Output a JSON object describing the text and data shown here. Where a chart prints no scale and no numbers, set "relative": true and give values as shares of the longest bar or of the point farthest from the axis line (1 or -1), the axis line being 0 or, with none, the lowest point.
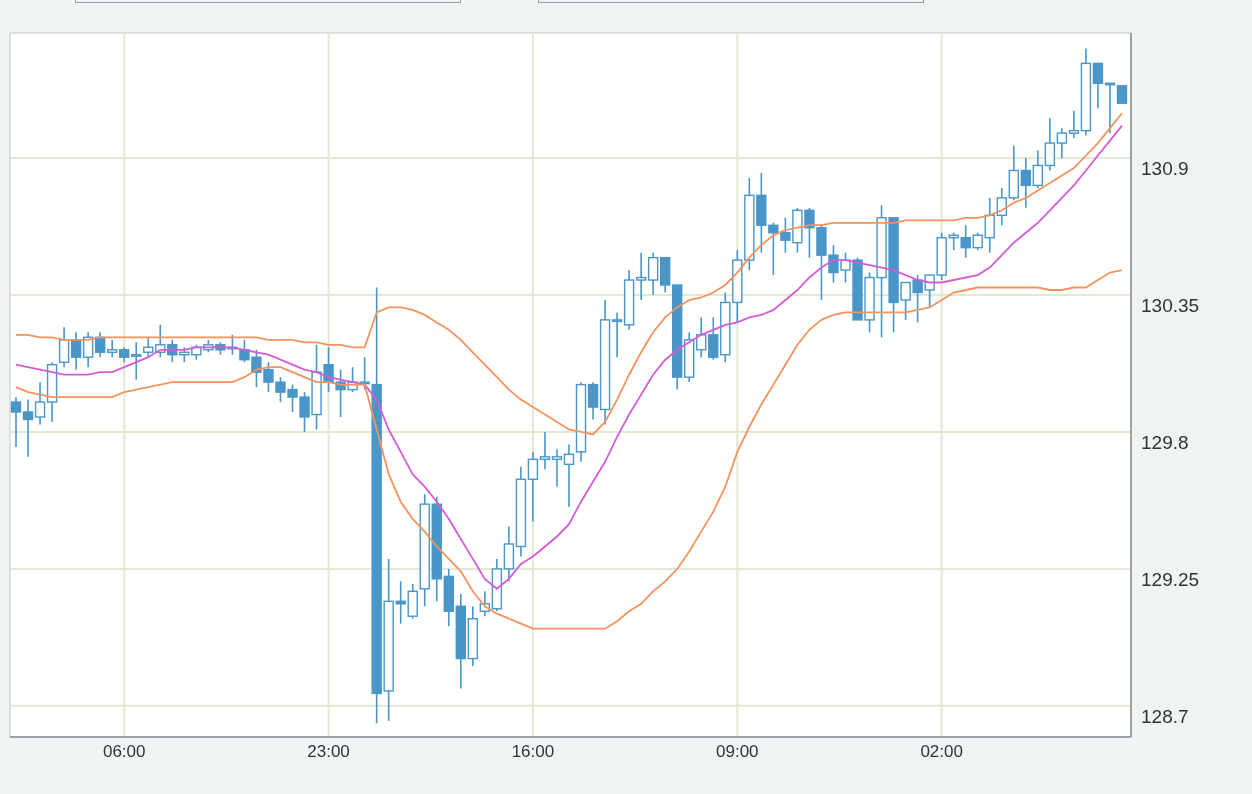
{
  "chart": {
    "chart_data": {
      "type": "candlestick",
      "grid": true,
      "categories": [
        null,
        null,
        null,
        null,
        null,
        null,
        null,
        null,
        null,
        "06:00",
        null,
        null,
        null,
        null,
        null,
        null,
        null,
        null,
        null,
        null,
        null,
        null,
        null,
        null,
        null,
        null,
        "23:00",
        null,
        null,
        null,
        null,
        null,
        null,
        null,
        null,
        null,
        null,
        null,
        null,
        null,
        null,
        null,
        null,
        "16:00",
        null,
        null,
        null,
        null,
        null,
        null,
        null,
        null,
        null,
        null,
        null,
        null,
        null,
        null,
        null,
        null,
        "09:00",
        null,
        null,
        null,
        null,
        null,
        null,
        null,
        null,
        null,
        null,
        null,
        null,
        null,
        null,
        null,
        null,
        "02:00",
        null,
        null,
        null,
        null,
        null,
        null,
        null,
        null,
        null,
        null,
        null,
        null,
        null,
        null,
        null
      ],
      "ylim": [
        128.575,
        131.402
      ],
      "yticks": [
        128.7,
        129.25,
        129.8,
        130.35,
        130.9
      ],
      "ohlc": [
        [
          129.92,
          129.94,
          129.74,
          129.88
        ],
        [
          129.88,
          129.93,
          129.7,
          129.85
        ],
        [
          129.86,
          130.0,
          129.83,
          129.92
        ],
        [
          129.92,
          130.08,
          129.84,
          130.07
        ],
        [
          130.08,
          130.22,
          130.06,
          130.17
        ],
        [
          130.17,
          130.2,
          130.05,
          130.1
        ],
        [
          130.1,
          130.2,
          130.06,
          130.18
        ],
        [
          130.18,
          130.2,
          130.1,
          130.12
        ],
        [
          130.12,
          130.17,
          130.1,
          130.13
        ],
        [
          130.13,
          130.14,
          130.08,
          130.1
        ],
        [
          130.11,
          130.16,
          130.01,
          130.11
        ],
        [
          130.12,
          130.18,
          130.1,
          130.14
        ],
        [
          130.12,
          130.23,
          130.1,
          130.15
        ],
        [
          130.15,
          130.17,
          130.08,
          130.11
        ],
        [
          130.11,
          130.14,
          130.08,
          130.12
        ],
        [
          130.11,
          130.15,
          130.09,
          130.14
        ],
        [
          130.13,
          130.17,
          130.12,
          130.15
        ],
        [
          130.15,
          130.16,
          130.11,
          130.13
        ],
        [
          130.14,
          130.19,
          130.11,
          130.14
        ],
        [
          130.13,
          130.17,
          130.08,
          130.09
        ],
        [
          130.1,
          130.13,
          129.98,
          130.04
        ],
        [
          130.05,
          130.08,
          129.96,
          130.0
        ],
        [
          130.0,
          130.02,
          129.92,
          129.96
        ],
        [
          129.97,
          129.99,
          129.88,
          129.94
        ],
        [
          129.94,
          129.96,
          129.8,
          129.86
        ],
        [
          129.87,
          130.15,
          129.81,
          130.04
        ],
        [
          130.07,
          130.14,
          129.96,
          130.0
        ],
        [
          130.0,
          130.05,
          129.86,
          129.97
        ],
        [
          129.97,
          130.06,
          129.96,
          130.0
        ],
        [
          130.0,
          130.1,
          129.97,
          130.0
        ],
        [
          129.99,
          130.38,
          128.63,
          128.75
        ],
        [
          128.76,
          129.29,
          128.64,
          129.12
        ],
        [
          129.12,
          129.2,
          129.03,
          129.11
        ],
        [
          129.06,
          129.19,
          129.05,
          129.16
        ],
        [
          129.17,
          129.55,
          129.1,
          129.51
        ],
        [
          129.51,
          129.54,
          129.12,
          129.21
        ],
        [
          129.22,
          129.25,
          129.02,
          129.08
        ],
        [
          129.1,
          129.15,
          128.77,
          128.89
        ],
        [
          128.89,
          129.1,
          128.86,
          129.05
        ],
        [
          129.08,
          129.16,
          129.06,
          129.11
        ],
        [
          129.09,
          129.29,
          129.08,
          129.25
        ],
        [
          129.25,
          129.42,
          129.2,
          129.35
        ],
        [
          129.34,
          129.66,
          129.3,
          129.61
        ],
        [
          129.61,
          129.72,
          129.44,
          129.69
        ],
        [
          129.69,
          129.8,
          129.65,
          129.7
        ],
        [
          129.69,
          129.73,
          129.58,
          129.7
        ],
        [
          129.67,
          129.75,
          129.5,
          129.71
        ],
        [
          129.72,
          130.0,
          129.68,
          129.99
        ],
        [
          129.99,
          130.0,
          129.85,
          129.9
        ],
        [
          129.89,
          130.33,
          129.83,
          130.25
        ],
        [
          130.25,
          130.28,
          130.1,
          130.25
        ],
        [
          130.23,
          130.45,
          130.21,
          130.41
        ],
        [
          130.41,
          130.52,
          130.33,
          130.42
        ],
        [
          130.41,
          130.52,
          130.35,
          130.5
        ],
        [
          130.5,
          130.5,
          130.36,
          130.39
        ],
        [
          130.39,
          130.39,
          129.97,
          130.02
        ],
        [
          130.02,
          130.2,
          130.0,
          130.17
        ],
        [
          130.13,
          130.26,
          130.1,
          130.19
        ],
        [
          130.19,
          130.26,
          130.09,
          130.1
        ],
        [
          130.11,
          130.36,
          130.08,
          130.32
        ],
        [
          130.32,
          130.53,
          130.24,
          130.49
        ],
        [
          130.49,
          130.82,
          130.45,
          130.75
        ],
        [
          130.75,
          130.84,
          130.52,
          130.63
        ],
        [
          130.63,
          130.64,
          130.43,
          130.6
        ],
        [
          130.6,
          130.66,
          130.52,
          130.57
        ],
        [
          130.56,
          130.7,
          130.52,
          130.69
        ],
        [
          130.69,
          130.7,
          130.5,
          130.62
        ],
        [
          130.62,
          130.63,
          130.33,
          130.51
        ],
        [
          130.51,
          130.55,
          130.4,
          130.44
        ],
        [
          130.45,
          130.52,
          130.4,
          130.49
        ],
        [
          130.49,
          130.5,
          130.25,
          130.25
        ],
        [
          130.25,
          130.44,
          130.2,
          130.42
        ],
        [
          130.42,
          130.71,
          130.18,
          130.66
        ],
        [
          130.66,
          130.66,
          130.2,
          130.32
        ],
        [
          130.33,
          130.4,
          130.25,
          130.4
        ],
        [
          130.41,
          130.43,
          130.24,
          130.36
        ],
        [
          130.37,
          130.43,
          130.3,
          130.43
        ],
        [
          130.43,
          130.6,
          130.41,
          130.58
        ],
        [
          130.58,
          130.6,
          130.53,
          130.59
        ],
        [
          130.58,
          130.63,
          130.5,
          130.54
        ],
        [
          130.54,
          130.6,
          130.53,
          130.59
        ],
        [
          130.58,
          130.74,
          130.52,
          130.67
        ],
        [
          130.67,
          130.78,
          130.63,
          130.74
        ],
        [
          130.74,
          130.95,
          130.73,
          130.85
        ],
        [
          130.85,
          130.9,
          130.7,
          130.79
        ],
        [
          130.79,
          130.93,
          130.78,
          130.87
        ],
        [
          130.87,
          131.06,
          130.85,
          130.96
        ],
        [
          130.96,
          131.02,
          130.9,
          131.0
        ],
        [
          131.0,
          131.09,
          130.98,
          131.01
        ],
        [
          131.01,
          131.34,
          130.99,
          131.28
        ],
        [
          131.28,
          131.28,
          131.1,
          131.2
        ],
        [
          131.2,
          131.2,
          131.0,
          131.2
        ],
        [
          131.19,
          131.19,
          131.12,
          131.12
        ]
      ]
    },
    "bands": {
      "chart_data": {
        "type": "line",
        "relative": true,
        "ylim": [
          128.575,
          131.402
        ],
        "series": [
          {
            "color": "#f4935e",
            "values": [
              130.19,
              130.19,
              130.18,
              130.18,
              130.17,
              130.17,
              130.17,
              130.18,
              130.18,
              130.18,
              130.18,
              130.18,
              130.18,
              130.18,
              130.18,
              130.18,
              130.18,
              130.18,
              130.18,
              130.18,
              130.18,
              130.17,
              130.17,
              130.17,
              130.16,
              130.16,
              130.15,
              130.15,
              130.14,
              130.14,
              130.28,
              130.3,
              130.3,
              130.29,
              130.27,
              130.24,
              130.21,
              130.17,
              130.12,
              130.07,
              130.02,
              129.97,
              129.93,
              129.9,
              129.87,
              129.84,
              129.81,
              129.8,
              129.79,
              129.84,
              129.93,
              130.03,
              130.12,
              130.2,
              130.26,
              130.3,
              130.33,
              130.34,
              130.36,
              130.39,
              130.44,
              130.5,
              130.55,
              130.59,
              130.61,
              130.62,
              130.63,
              130.63,
              130.64,
              130.64,
              130.64,
              130.64,
              130.64,
              130.64,
              130.65,
              130.65,
              130.65,
              130.65,
              130.65,
              130.66,
              130.66,
              130.67,
              130.69,
              130.72,
              130.74,
              130.77,
              130.8,
              130.83,
              130.86,
              130.91,
              130.96,
              131.02,
              131.08
            ]
          },
          {
            "color": "#d45cd6",
            "values": [
              130.07,
              130.06,
              130.05,
              130.04,
              130.03,
              130.03,
              130.03,
              130.04,
              130.04,
              130.06,
              130.08,
              130.1,
              130.13,
              130.13,
              130.13,
              130.14,
              130.14,
              130.14,
              130.14,
              130.13,
              130.12,
              130.11,
              130.09,
              130.07,
              130.05,
              130.04,
              130.02,
              130.01,
              130.0,
              129.99,
              129.93,
              129.81,
              129.72,
              129.63,
              129.58,
              129.52,
              129.45,
              129.37,
              129.29,
              129.21,
              129.17,
              129.21,
              129.27,
              129.3,
              129.34,
              129.38,
              129.43,
              129.52,
              129.6,
              129.68,
              129.78,
              129.87,
              129.95,
              130.03,
              130.09,
              130.13,
              130.16,
              130.19,
              130.21,
              130.23,
              130.24,
              130.26,
              130.27,
              130.29,
              130.33,
              130.37,
              130.42,
              130.46,
              130.49,
              130.49,
              130.48,
              130.47,
              130.46,
              130.45,
              130.43,
              130.41,
              130.4,
              130.4,
              130.41,
              130.42,
              130.43,
              130.46,
              130.51,
              130.56,
              130.6,
              130.64,
              130.69,
              130.74,
              130.79,
              130.85,
              130.91,
              130.97,
              131.03
            ]
          },
          {
            "color": "#f4935e",
            "values": [
              129.98,
              129.96,
              129.95,
              129.94,
              129.94,
              129.94,
              129.94,
              129.94,
              129.94,
              129.96,
              129.97,
              129.98,
              129.99,
              130.0,
              130.0,
              130.0,
              130.0,
              130.0,
              130.0,
              130.02,
              130.05,
              130.06,
              130.06,
              130.04,
              130.02,
              130.0,
              130.0,
              129.99,
              129.99,
              129.99,
              129.81,
              129.63,
              129.52,
              129.45,
              129.4,
              129.34,
              129.29,
              129.24,
              129.16,
              129.1,
              129.07,
              129.05,
              129.03,
              129.01,
              129.01,
              129.01,
              129.01,
              129.01,
              129.01,
              129.01,
              129.04,
              129.08,
              129.11,
              129.16,
              129.2,
              129.25,
              129.32,
              129.4,
              129.48,
              129.58,
              129.72,
              129.82,
              129.91,
              129.99,
              130.07,
              130.15,
              130.21,
              130.25,
              130.27,
              130.28,
              130.28,
              130.28,
              130.28,
              130.28,
              130.28,
              130.29,
              130.3,
              130.33,
              130.36,
              130.37,
              130.38,
              130.38,
              130.38,
              130.38,
              130.38,
              130.38,
              130.37,
              130.37,
              130.38,
              130.38,
              130.41,
              130.44,
              130.45
            ]
          }
        ]
      }
    }
  }
}
